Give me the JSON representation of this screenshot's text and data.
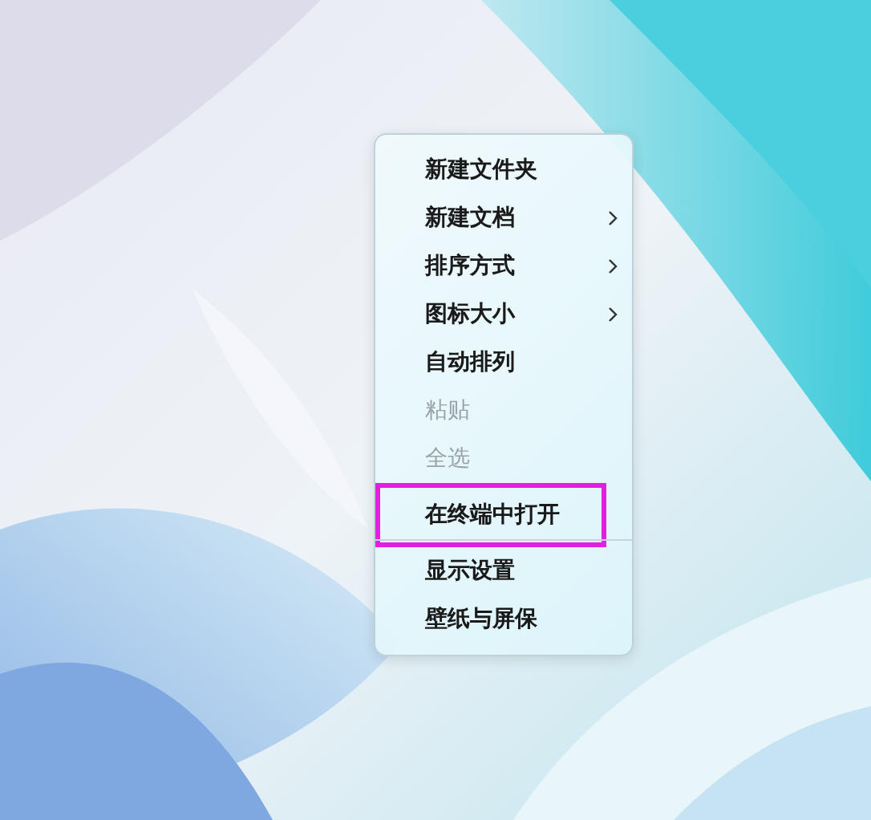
{
  "context_menu": {
    "items": [
      {
        "label": "新建文件夹",
        "has_submenu": false,
        "disabled": false,
        "highlighted": false,
        "separator_after": false
      },
      {
        "label": "新建文档",
        "has_submenu": true,
        "disabled": false,
        "highlighted": false,
        "separator_after": false
      },
      {
        "label": "排序方式",
        "has_submenu": true,
        "disabled": false,
        "highlighted": false,
        "separator_after": false
      },
      {
        "label": "图标大小",
        "has_submenu": true,
        "disabled": false,
        "highlighted": false,
        "separator_after": false
      },
      {
        "label": "自动排列",
        "has_submenu": false,
        "disabled": false,
        "highlighted": false,
        "separator_after": false
      },
      {
        "label": "粘贴",
        "has_submenu": false,
        "disabled": true,
        "highlighted": false,
        "separator_after": false
      },
      {
        "label": "全选",
        "has_submenu": false,
        "disabled": true,
        "highlighted": false,
        "separator_after": false
      },
      {
        "label": "在终端中打开",
        "has_submenu": false,
        "disabled": false,
        "highlighted": true,
        "separator_after": true
      },
      {
        "label": "显示设置",
        "has_submenu": false,
        "disabled": false,
        "highlighted": false,
        "separator_after": false
      },
      {
        "label": "壁纸与屏保",
        "has_submenu": false,
        "disabled": false,
        "highlighted": false,
        "separator_after": false
      }
    ]
  }
}
